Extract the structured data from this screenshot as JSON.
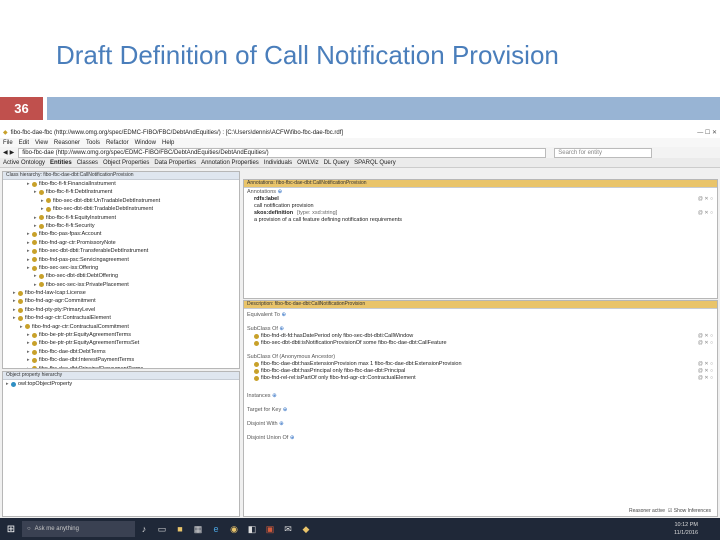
{
  "slide": {
    "title": "Draft Definition of Call Notification Provision",
    "page_number": "36"
  },
  "app": {
    "window_title": "fibo-fbc-dae-fbc (http://www.omg.org/spec/EDMC-FIBO/FBC/DebtAndEquities/) : [C:\\Users\\dennis\\ACFW\\fibo-fbc-dae-fbc.rdf]",
    "menu": [
      "File",
      "Edit",
      "View",
      "Reasoner",
      "Tools",
      "Refactor",
      "Window",
      "Help"
    ],
    "address": "fibo-fbc-dae (http://www.omg.org/spec/EDMC-FIBO/FBC/DebtAndEquities/DebtAndEquities/)",
    "search_placeholder": "Search for entity",
    "tabs": [
      "Active Ontology",
      "Entities",
      "Classes",
      "Object Properties",
      "Data Properties",
      "Annotation Properties",
      "Individuals",
      "OWLViz",
      "DL Query",
      "SPARQL Query"
    ],
    "class_hierarchy_header": "Class hierarchy: fibo-fbc-dae-dbt:CallNotificationProvision",
    "tree": [
      {
        "label": "fibo-fbc-fi-fi:FinancialInstrument",
        "indent": 3,
        "sel": false
      },
      {
        "label": "fibo-fbc-fi-fi:DebtInstrument",
        "indent": 4,
        "sel": false
      },
      {
        "label": "fibo-sec-dbt-dbti:UnTradableDebtInstrument",
        "indent": 5,
        "sel": false
      },
      {
        "label": "fibo-sec-dbt-dbti:TradableDebtInstrument",
        "indent": 5,
        "sel": false
      },
      {
        "label": "fibo-fbc-fi-fi:EquityInstrument",
        "indent": 4,
        "sel": false
      },
      {
        "label": "fibo-fbc-fi-fi:Security",
        "indent": 4,
        "sel": false
      },
      {
        "label": "fibo-fbc-pas-fpas:Account",
        "indent": 3,
        "sel": false
      },
      {
        "label": "fibo-fnd-agr-ctr:PromissoryNote",
        "indent": 3,
        "sel": false
      },
      {
        "label": "fibo-sec-dbt-dbti:TransferableDebtInstrument",
        "indent": 3,
        "sel": false
      },
      {
        "label": "fibo-fnd-pas-psc:Servicingagreement",
        "indent": 3,
        "sel": false
      },
      {
        "label": "fibo-sec-sec-iss:Offering",
        "indent": 3,
        "sel": false
      },
      {
        "label": "fibo-sec-dbt-dbti:DebtOffering",
        "indent": 4,
        "sel": false
      },
      {
        "label": "fibo-sec-sec-iss:PrivatePlacement",
        "indent": 4,
        "sel": false
      },
      {
        "label": "fibo-fnd-law-lcap:License",
        "indent": 1,
        "sel": false
      },
      {
        "label": "fibo-fnd-agr-agr:Commitment",
        "indent": 1,
        "sel": false
      },
      {
        "label": "fibo-fnd-pty-pty:PrimaryLevel",
        "indent": 1,
        "sel": false
      },
      {
        "label": "fibo-fnd-agr-ctr:ContractualElement",
        "indent": 1,
        "sel": false
      },
      {
        "label": "fibo-fnd-agr-ctr:ContractualCommitment",
        "indent": 2,
        "sel": false
      },
      {
        "label": "fibo-be-ptr-ptr:EquityAgreementTerms",
        "indent": 3,
        "sel": false
      },
      {
        "label": "fibo-be-ptr-ptr:EquityAgreementTermsSet",
        "indent": 3,
        "sel": false
      },
      {
        "label": "fibo-fbc-dae-dbt:DebtTerms",
        "indent": 3,
        "sel": false
      },
      {
        "label": "fibo-fbc-dae-dbt:InterestPaymentTerms",
        "indent": 3,
        "sel": false
      },
      {
        "label": "fibo-fbc-dae-dbt:PrincipalRepaymentTerms",
        "indent": 3,
        "sel": false
      },
      {
        "label": "fibo-sec-dbt-dbti:RedemptionProvision",
        "indent": 3,
        "sel": false
      },
      {
        "label": "fibo-sec-dbt-dbti:ConvertibleFeatureProvision",
        "indent": 4,
        "sel": false
      },
      {
        "label": "fibo-sec-dbt-dbti:DebtInstrumentRedemptionProvision",
        "indent": 4,
        "sel": false
      },
      {
        "label": "fibo-fbc-dae-dbt:CallFeature",
        "indent": 5,
        "sel": false
      },
      {
        "label": "fibo-fbc-dae-dbt:CallNotificationProvision",
        "indent": 5,
        "sel": true
      }
    ],
    "object_props_header": "Object property hierarchy",
    "object_props": [
      "owl:topObjectProperty"
    ],
    "annotations_header": "Annotations: fibo-fbc-dae-dbt:CallNotificationProvision",
    "annotations": {
      "section": "Annotations",
      "label_key": "rdfs:label",
      "label_value": "call notification provision",
      "def_key": "skos:definition",
      "def_type": "[type: xsd:string]",
      "def_value": "a provision of a call feature defining notification requirements"
    },
    "description_header": "Description: fibo-fbc-dae-dbt:CallNotificationProvision",
    "description": {
      "equivalent": "Equivalent To",
      "subclass": "SubClass Of",
      "subclass_items": [
        "fibo-fnd-dt-fd:hasDatePeriod only fibo-sec-dbt-dbti:CallWindow",
        "fibo-sec-dbt-dbti:isNotificationProvisionOf some fibo-fbc-dae-dbt:CallFeature"
      ],
      "inherited": "SubClass Of (Anonymous Ancestor)",
      "inherited_items": [
        "fibo-fbc-dae-dbt:hasExtensionProvision max 1 fibo-fbc-dae-dbt:ExtensionProvision",
        "fibo-fbc-dae-dbt:hasPrincipal only fibo-fbc-dae-dbt:Principal",
        "fibo-fnd-rel-rel:isPartOf only fibo-fnd-agr-ctr:ContractualElement"
      ],
      "instances": "Instances",
      "target_key": "Target for Key",
      "disjoint": "Disjoint With",
      "disjoint_union": "Disjoint Union Of"
    },
    "status": {
      "reasoner": "Reasoner active",
      "show_inferences": "Show Inferences"
    },
    "taskbar": {
      "search": "Ask me anything",
      "time": "10:12 PM",
      "date": "11/1/2016"
    }
  }
}
